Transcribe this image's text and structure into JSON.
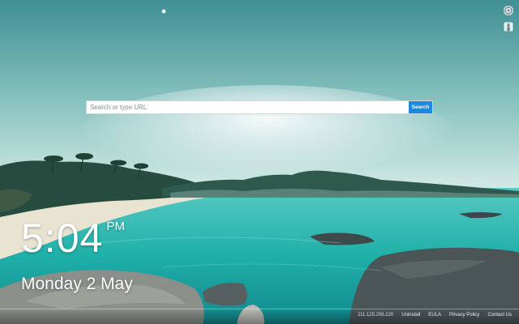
{
  "search": {
    "placeholder": "Search or type URL",
    "button_label": "Search"
  },
  "clock": {
    "time": "5:04",
    "ampm": "PM",
    "date": "Monday 2 May"
  },
  "footer": {
    "ip": "111.125.208.220",
    "links": [
      "Uninstall",
      "EULA",
      "Privacy Policy",
      "Contact Us"
    ]
  },
  "corner_icons": [
    "settings-icon",
    "weather-icon"
  ],
  "colors": {
    "search_button": "#1e88e5",
    "sea": "#2fb2ad",
    "sky": "#4f9ea0"
  }
}
